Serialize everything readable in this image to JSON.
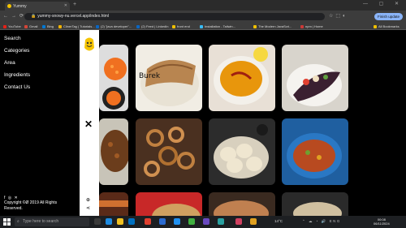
{
  "browser": {
    "tab_title": "Yummy",
    "url": "yummy-snowy-nu.vercel.app/index.html",
    "profile_button": "Finish update",
    "window_controls": "— ▢ ✕"
  },
  "bookmarks": [
    {
      "label": "YouTube",
      "color": "#e62117"
    },
    {
      "label": "Gmail",
      "color": "#d44638"
    },
    {
      "label": "Bing",
      "color": "#0078d4"
    },
    {
      "label": "ClinerTag | Tutorials...",
      "color": "#f4b400"
    },
    {
      "label": "(2) \"java developer\"...",
      "color": "#0a66c2"
    },
    {
      "label": "(2) Feed | LinkedIn",
      "color": "#0a66c2"
    },
    {
      "label": "front end",
      "color": "#f0c000"
    },
    {
      "label": "Installation - Tailwin...",
      "color": "#38bdf8"
    },
    {
      "label": "The Modern JavaScri...",
      "color": "#f0c000"
    },
    {
      "label": "npm | Home",
      "color": "#cb3837"
    },
    {
      "label": "All Bookmarks",
      "color": "#f0c000"
    }
  ],
  "sidebar": {
    "items": [
      "Search",
      "Categories",
      "Area",
      "Ingredients",
      "Contact Us"
    ],
    "social": "f ◎ ✕",
    "copyright": "Copyright ©Ø 2019 All Rights Reserved."
  },
  "meals": [
    {
      "name": "sushi",
      "label": ""
    },
    {
      "name": "burek",
      "label": "Burek"
    },
    {
      "name": "lentil-soup",
      "label": ""
    },
    {
      "name": "stuffed-eggplant",
      "label": ""
    },
    {
      "name": "koshari",
      "label": ""
    },
    {
      "name": "kafteji",
      "label": ""
    },
    {
      "name": "dumplings",
      "label": ""
    },
    {
      "name": "tagine",
      "label": ""
    },
    {
      "name": "lasagne",
      "label": ""
    },
    {
      "name": "stew",
      "label": ""
    },
    {
      "name": "pastries",
      "label": ""
    },
    {
      "name": "shawarma",
      "label": ""
    }
  ],
  "taskbar": {
    "search_placeholder": "Type here to search",
    "weather": "14°C",
    "clock_time": "00:08",
    "clock_date": "06/11/2024",
    "tray_text": "ENG"
  }
}
